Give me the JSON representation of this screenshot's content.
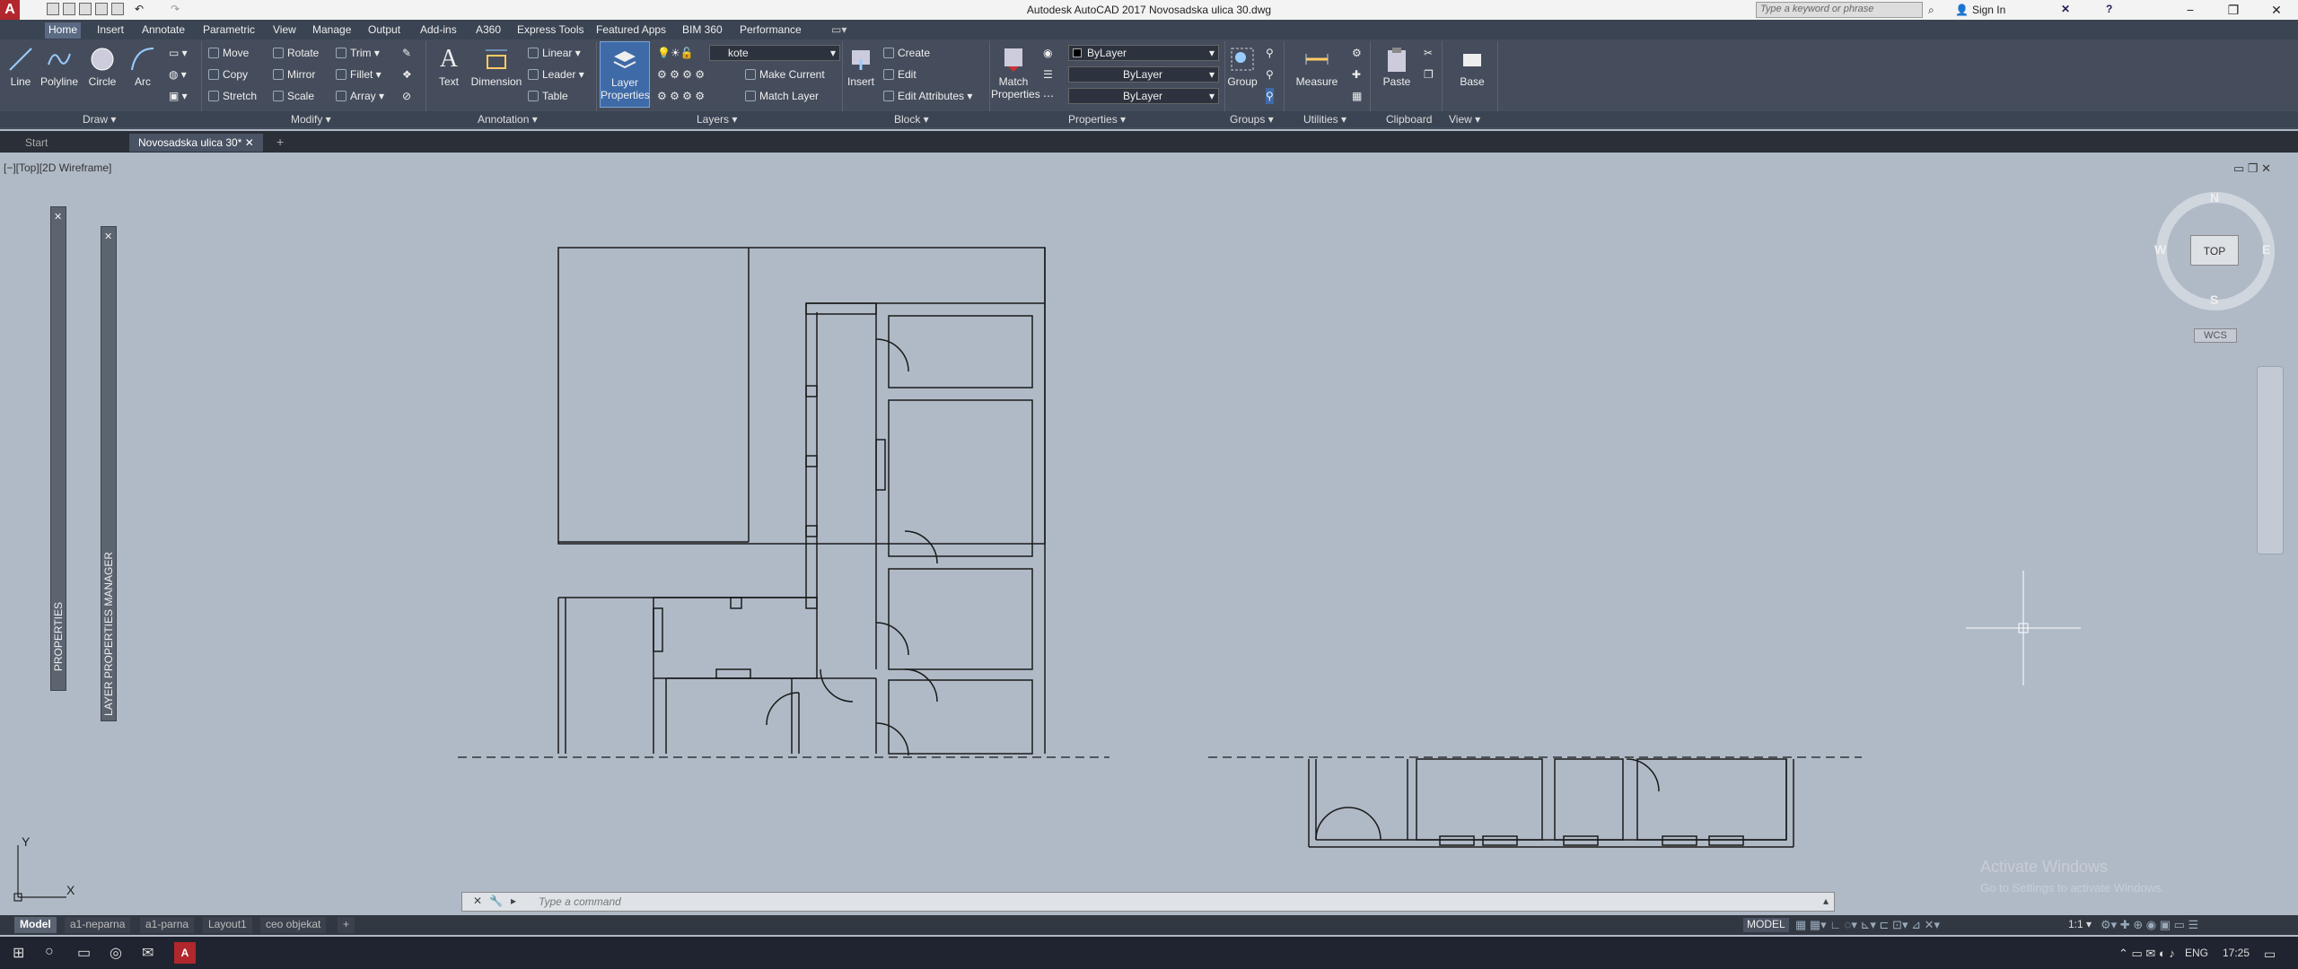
{
  "titlebar": {
    "app_logo": "A",
    "title": "Autodesk AutoCAD 2017    Novosadska ulica 30.dwg",
    "search_placeholder": "Type a keyword or phrase",
    "sign_in": "Sign In"
  },
  "ribbon_tabs": [
    "Home",
    "Insert",
    "Annotate",
    "Parametric",
    "View",
    "Manage",
    "Output",
    "Add-ins",
    "A360",
    "Express Tools",
    "Featured Apps",
    "BIM 360",
    "Performance"
  ],
  "ribbon": {
    "draw": {
      "line": "Line",
      "polyline": "Polyline",
      "circle": "Circle",
      "arc": "Arc",
      "label": "Draw"
    },
    "modify": {
      "move": "Move",
      "rotate": "Rotate",
      "trim": "Trim",
      "copy": "Copy",
      "mirror": "Mirror",
      "fillet": "Fillet",
      "stretch": "Stretch",
      "scale": "Scale",
      "array": "Array",
      "label": "Modify"
    },
    "annotation": {
      "text": "Text",
      "dimension": "Dimension",
      "linear": "Linear",
      "leader": "Leader",
      "table": "Table",
      "label": "Annotation"
    },
    "layers": {
      "layer_properties_line1": "Layer",
      "layer_properties_line2": "Properties",
      "current_layer": "kote",
      "make_current": "Make Current",
      "match_layer": "Match Layer",
      "label": "Layers"
    },
    "block": {
      "insert": "Insert",
      "create": "Create",
      "edit": "Edit",
      "edit_attributes": "Edit Attributes",
      "label": "Block"
    },
    "properties": {
      "match_line1": "Match",
      "match_line2": "Properties",
      "color": "ByLayer",
      "linetype": "ByLayer",
      "lineweight": "ByLayer",
      "label": "Properties"
    },
    "groups": {
      "group": "Group",
      "label": "Groups"
    },
    "utilities": {
      "measure": "Measure",
      "label": "Utilities"
    },
    "clipboard": {
      "paste": "Paste",
      "label": "Clipboard"
    },
    "view": {
      "base": "Base",
      "label": "View"
    }
  },
  "doc_tabs": {
    "start": "Start",
    "current": "Novosadska ulica 30*"
  },
  "viewport_label": "[−][Top][2D Wireframe]",
  "palettes": {
    "properties": "PROPERTIES",
    "layer_manager": "LAYER PROPERTIES MANAGER"
  },
  "viewcube": {
    "top": "TOP",
    "n": "N",
    "s": "S",
    "e": "E",
    "w": "W",
    "wcs": "WCS"
  },
  "ucs": {
    "x": "X",
    "y": "Y"
  },
  "command": {
    "placeholder": "Type a command"
  },
  "layout_tabs": [
    "Model",
    "a1-neparna",
    "a1-parna",
    "Layout1",
    "ceo objekat"
  ],
  "status": {
    "model": "MODEL",
    "scale": "1:1"
  },
  "watermark": {
    "line1": "Activate Windows",
    "line2": "Go to Settings to activate Windows."
  },
  "tray": {
    "lang": "ENG",
    "time": "17:25"
  },
  "colors": {
    "canvas": "#b0bac7",
    "ribbon": "#454d5c",
    "accent": "#b1272d"
  }
}
